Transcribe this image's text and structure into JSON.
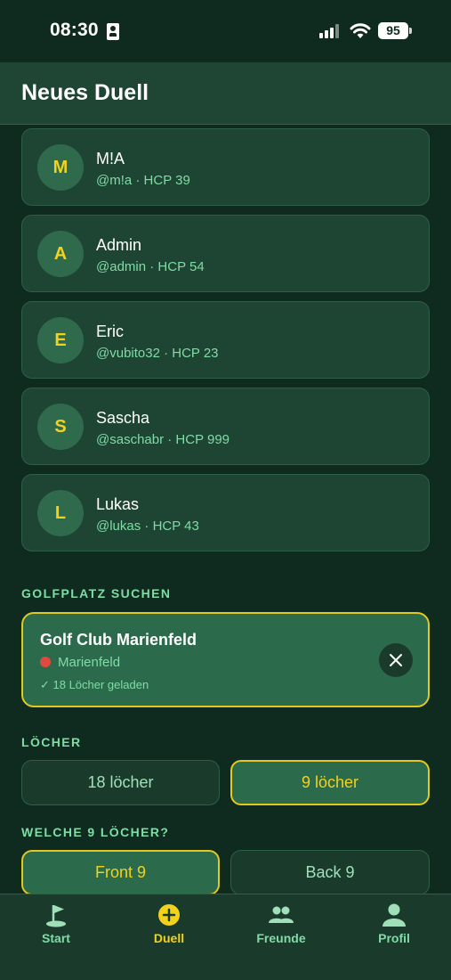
{
  "status_bar": {
    "time": "08:30",
    "battery": "95"
  },
  "header": {
    "title": "Neues Duell"
  },
  "friends": [
    {
      "initial": "M",
      "name": "M!A",
      "meta": "@m!a · HCP 39"
    },
    {
      "initial": "A",
      "name": "Admin",
      "meta": "@admin · HCP 54"
    },
    {
      "initial": "E",
      "name": "Eric",
      "meta": "@vubito32 · HCP 23"
    },
    {
      "initial": "S",
      "name": "Sascha",
      "meta": "@saschabr · HCP 999"
    },
    {
      "initial": "L",
      "name": "Lukas",
      "meta": "@lukas · HCP 43"
    }
  ],
  "course_section": {
    "label": "GOLFPLATZ SUCHEN",
    "selected": {
      "name": "Golf Club Marienfeld",
      "location": "Marienfeld",
      "status": "✓ 18 Löcher geladen"
    }
  },
  "holes_section": {
    "label": "LÖCHER",
    "options": [
      "18 löcher",
      "9 löcher"
    ],
    "selected": "9 löcher"
  },
  "nine_section": {
    "label": "WELCHE 9 LÖCHER?",
    "options": [
      "Front 9",
      "Back 9"
    ],
    "selected": "Front 9"
  },
  "tabs": [
    {
      "label": "Start",
      "icon": "flag-icon"
    },
    {
      "label": "Duell",
      "icon": "plus-circle-icon"
    },
    {
      "label": "Freunde",
      "icon": "friends-icon"
    },
    {
      "label": "Profil",
      "icon": "person-icon"
    }
  ],
  "active_tab": "Duell",
  "colors": {
    "background": "#0f2a1f",
    "card": "#1e4434",
    "accent": "#f2d21b",
    "muted": "#7fdca5"
  }
}
